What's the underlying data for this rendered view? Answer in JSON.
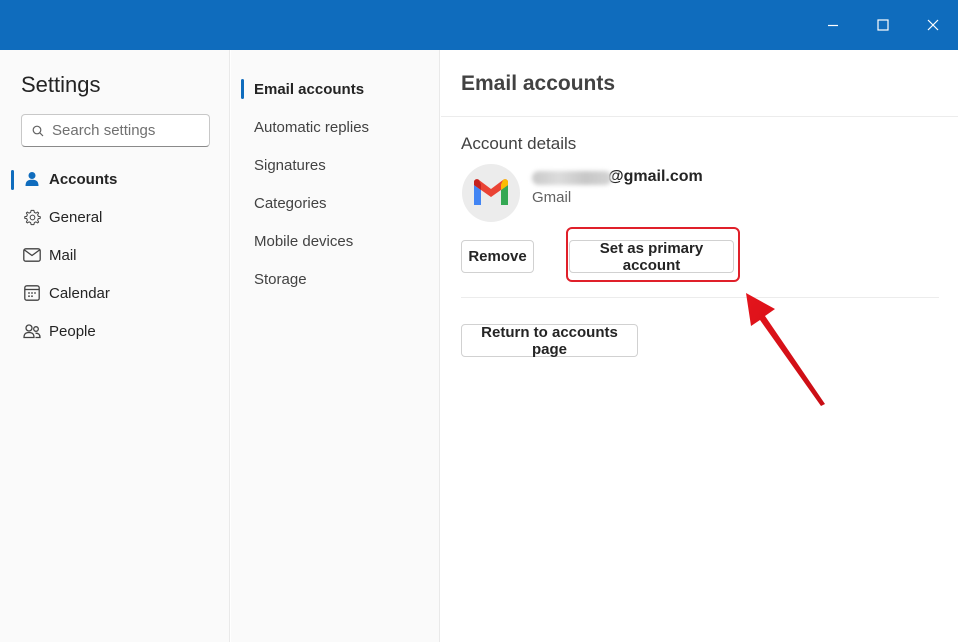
{
  "window": {
    "controls": {
      "minimize": "minimize-icon",
      "maximize": "maximize-icon",
      "close": "close-icon"
    },
    "titlebar_color": "#0f6cbd"
  },
  "sidebar": {
    "title": "Settings",
    "search": {
      "placeholder": "Search settings",
      "icon": "search-icon"
    },
    "items": [
      {
        "label": "Accounts",
        "icon": "person-icon",
        "active": true
      },
      {
        "label": "General",
        "icon": "gear-icon",
        "active": false
      },
      {
        "label": "Mail",
        "icon": "mail-icon",
        "active": false
      },
      {
        "label": "Calendar",
        "icon": "calendar-icon",
        "active": false
      },
      {
        "label": "People",
        "icon": "people-icon",
        "active": false
      }
    ]
  },
  "subnav": {
    "items": [
      {
        "label": "Email accounts",
        "active": true
      },
      {
        "label": "Automatic replies",
        "active": false
      },
      {
        "label": "Signatures",
        "active": false
      },
      {
        "label": "Categories",
        "active": false
      },
      {
        "label": "Mobile devices",
        "active": false
      },
      {
        "label": "Storage",
        "active": false
      }
    ]
  },
  "main": {
    "title": "Email accounts",
    "section_label": "Account details",
    "account": {
      "email_visible": "@gmail.com",
      "provider": "Gmail",
      "avatar_icon": "gmail-logo-icon"
    },
    "buttons": {
      "remove": "Remove",
      "set_primary": "Set as primary account",
      "return": "Return to accounts page"
    }
  },
  "accent_color": "#0f6cbd",
  "annotation_color": "#e0202a"
}
